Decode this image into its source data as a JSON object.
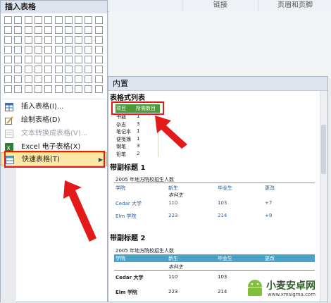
{
  "ribbon": {
    "links_label": "链接",
    "header_footer_label": "页眉和页脚"
  },
  "insert_menu": {
    "title": "插入表格",
    "items": [
      {
        "label": "插入表格(I)...",
        "icon": "table-grid-icon",
        "enabled": true
      },
      {
        "label": "绘制表格(D)",
        "icon": "pencil-table-icon",
        "enabled": true
      },
      {
        "label": "文本转换成表格(V)...",
        "icon": "text-to-table-icon",
        "enabled": false
      },
      {
        "label": "Excel 电子表格(X)",
        "icon": "excel-icon",
        "enabled": true
      },
      {
        "label": "快速表格(T)",
        "icon": "quick-table-icon",
        "enabled": true,
        "highlighted": true
      }
    ]
  },
  "gallery": {
    "header": "内置",
    "matrix_list": {
      "title": "表格式列表",
      "col1": "项目",
      "col2": "所需数目",
      "rows": [
        [
          "书籍",
          "1"
        ],
        [
          "杂志",
          "3"
        ],
        [
          "笔记本",
          "1"
        ],
        [
          "便笺簿",
          "1"
        ],
        [
          "钢笔",
          "3"
        ],
        [
          "铅笔",
          "2"
        ]
      ]
    },
    "subheading1": {
      "title": "带副标题 1",
      "caption": "2005 年地方院校招生人数",
      "headers": [
        "学院",
        "新生",
        "毕业生",
        "更改"
      ],
      "sub": "本科生",
      "rows": [
        [
          "Cedar 大学",
          "110",
          "103",
          "+7"
        ],
        [
          "Elm 学院",
          "223",
          "214",
          "+9"
        ]
      ]
    },
    "subheading2": {
      "title": "带副标题 2",
      "caption": "2005 年地方院校招生人数",
      "headers": [
        "学院",
        "新生",
        "毕业生",
        "更改"
      ],
      "sub": "本科生",
      "rows": [
        [
          "Cedar 大学",
          "110",
          "103",
          ""
        ],
        [
          "Elm 学院",
          "223",
          "214",
          ""
        ]
      ]
    }
  },
  "watermark": {
    "text": "小麦安卓网",
    "url": "www.xmsigma.com"
  },
  "colors": {
    "menu_highlight": "#fbe7a6",
    "annotation_red": "#e31a1a",
    "table_accent": "#4aa3c6",
    "list_header": "#4e9a3a"
  }
}
